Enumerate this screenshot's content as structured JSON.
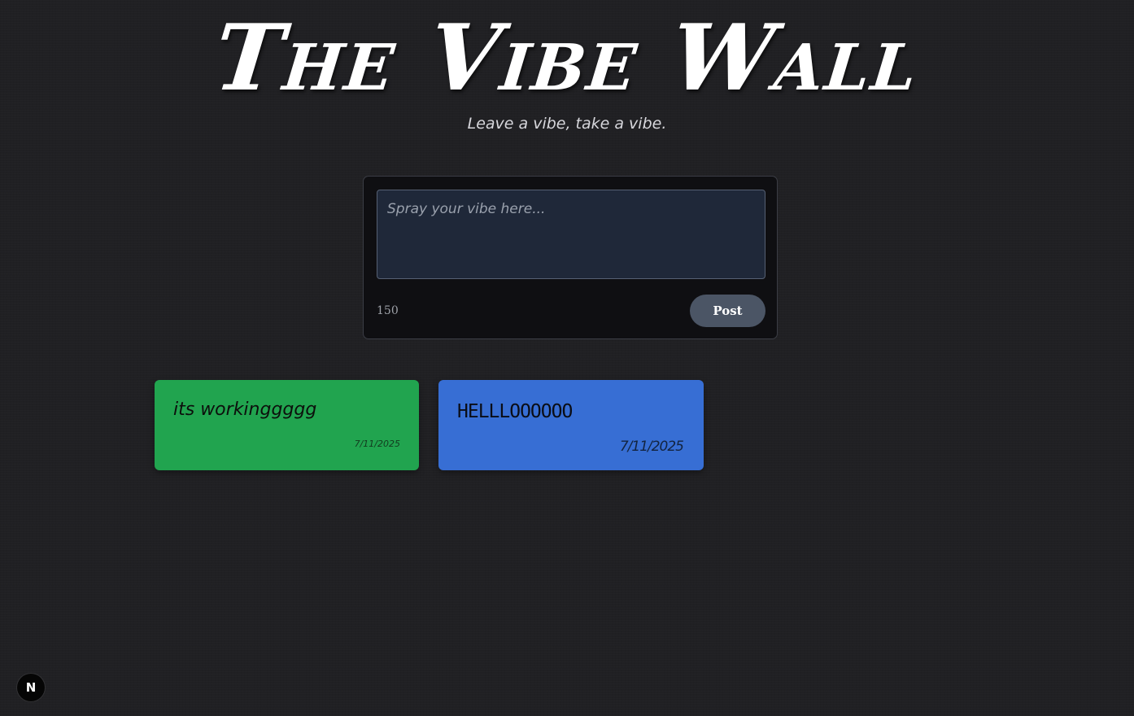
{
  "header": {
    "title": "The Vibe Wall",
    "subtitle": "Leave a vibe, take a vibe."
  },
  "composer": {
    "placeholder": "Spray your vibe here...",
    "value": "",
    "char_count": "150",
    "post_label": "Post"
  },
  "notes": [
    {
      "text": "its workinggggg",
      "date": "7/11/2025",
      "color": "#21a44f"
    },
    {
      "text": "HELLLOOOOOO",
      "date": "7/11/2025",
      "color": "#376ed4"
    }
  ],
  "dev_badge": {
    "label": "N",
    "icon": "nextjs-icon"
  },
  "colors": {
    "background": "#202023",
    "panel": "#0f0f12",
    "input": "#1f2839",
    "button": "#4b5565"
  }
}
